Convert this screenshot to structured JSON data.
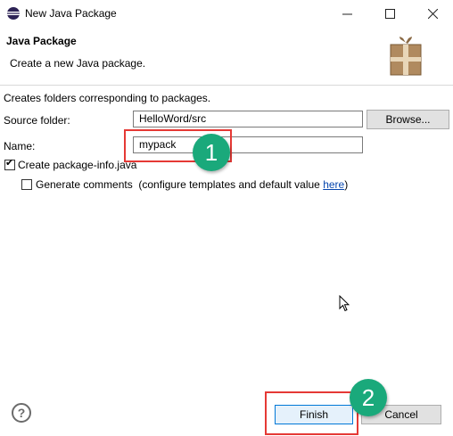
{
  "window": {
    "title": "New Java Package",
    "minimize_icon": "minimize-icon",
    "maximize_icon": "maximize-icon",
    "close_icon": "close-icon"
  },
  "header": {
    "title": "Java Package",
    "description": "Create a new Java package.",
    "icon": "package-icon"
  },
  "form": {
    "description": "Creates folders corresponding to packages.",
    "source_folder": {
      "label": "Source folder:",
      "value": "HelloWord/src",
      "browse_label": "Browse..."
    },
    "name": {
      "label": "Name:",
      "value": "mypack"
    },
    "create_package_info": {
      "label": "Create package-info.java",
      "checked": true
    },
    "generate_comments": {
      "label": "Generate comments",
      "note": "(configure templates and default value",
      "link": "here",
      "close": ")",
      "checked": false
    }
  },
  "footer": {
    "help_icon": "help-icon",
    "finish_label": "Finish",
    "cancel_label": "Cancel"
  },
  "annotations": {
    "marker_1": "1",
    "marker_2": "2",
    "highlight_color": "#e53935",
    "marker_color": "#1aa97b"
  }
}
